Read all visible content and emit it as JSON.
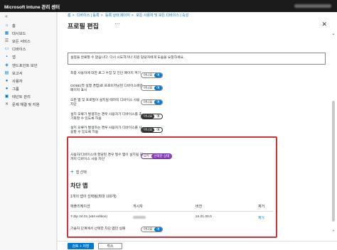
{
  "topbar": {
    "title": "Microsoft Intune 관리 센터"
  },
  "sidebar": {
    "collapse_icon": "«",
    "items": [
      {
        "label": "홈",
        "icon": "home-icon",
        "glyph": "⌂",
        "color": "#0078d4"
      },
      {
        "label": "대시보드",
        "icon": "dashboard-icon",
        "glyph": "▦",
        "color": "#0078d4"
      },
      {
        "label": "모든 서비스",
        "icon": "all-services-icon",
        "glyph": "☰",
        "color": "#605e5c"
      },
      {
        "label": "디바이스",
        "icon": "devices-icon",
        "glyph": "▭",
        "color": "#0078d4"
      },
      {
        "label": "앱",
        "icon": "apps-icon",
        "glyph": "▪",
        "color": "#0078d4"
      },
      {
        "label": "엔드포인트 보안",
        "icon": "endpoint-security-icon",
        "glyph": "◈",
        "color": "#0078d4"
      },
      {
        "label": "보고서",
        "icon": "reports-icon",
        "glyph": "▤",
        "color": "#0078d4"
      },
      {
        "label": "사용자",
        "icon": "users-icon",
        "glyph": "●",
        "color": "#0078d4"
      },
      {
        "label": "그룹",
        "icon": "groups-icon",
        "glyph": "●",
        "color": "#0078d4"
      },
      {
        "label": "테넌트 관리",
        "icon": "tenant-admin-icon",
        "glyph": "▣",
        "color": "#0078d4"
      },
      {
        "label": "문제 해결 및 지원",
        "icon": "troubleshoot-icon",
        "glyph": "✕",
        "color": "#605e5c"
      }
    ]
  },
  "breadcrumb": [
    "홈",
    "디바이스 | 등록",
    "등록 상태 페이지",
    "모든 사용자 및 모든 디바이스 | 속성"
  ],
  "page": {
    "title": "프로필 편집",
    "more": "···",
    "close": "✕"
  },
  "error_message": "설정을 완료할 수 없습니다. 다시 시도하거나 지원 담당자에게 도움을 요청하세요.",
  "settings": [
    {
      "label": "최종 사용자에 대한 로그 수집 및 진단 페이지 켜기",
      "no": "아니요",
      "yes": "예",
      "selected": "예"
    },
    {
      "label": "OOBE(첫 실행 경험)로 프로비저닝된 디바이스에만 페이지 표시",
      "no": "아니요",
      "yes": "예",
      "selected": "예"
    },
    {
      "label": "모든 앱 및 프로필이 설치될 때까지 디바이스 사용 차단",
      "no": "아니요",
      "yes": "예",
      "selected": "예"
    },
    {
      "label": "설치 오류가 발생하는 경우 사용자가 디바이스를 초기화할 수 있도록 허용",
      "no": "아니요",
      "yes": "예",
      "selected": "아니요"
    },
    {
      "label": "설치 오류가 발생하는 경우 사용자가 디바이스를 사용할 수 있도록 허용",
      "no": "아니요",
      "yes": "예",
      "selected": "아니요"
    }
  ],
  "block_setting": {
    "label": "사용자/디바이스에 할당된 경우 필수 앱이 설치될 때까지 디바이스 사용 차단",
    "all": "모두",
    "selected_label": "선택한 상태",
    "selected": "선택한 상태"
  },
  "add_app": "앱 선택",
  "blocking_apps": {
    "title": "차단 앱",
    "count_text": "1개의 앱이 선택됨(최대 100개)",
    "columns": [
      "애플리케이션",
      "게시자",
      "버전",
      "제거"
    ],
    "rows": [
      {
        "app": "7-Zip 24.01 (x64 edition)",
        "publisher": "",
        "version": "24.01.00.0",
        "remove": "제거"
      }
    ]
  },
  "technician_setting": {
    "label": "기술자 단계에서 선택한 차단 앱만 실패",
    "no": "아니요",
    "yes": "예",
    "selected": "예"
  },
  "footer": {
    "primary": "검토 + 저장",
    "secondary": "취소"
  }
}
